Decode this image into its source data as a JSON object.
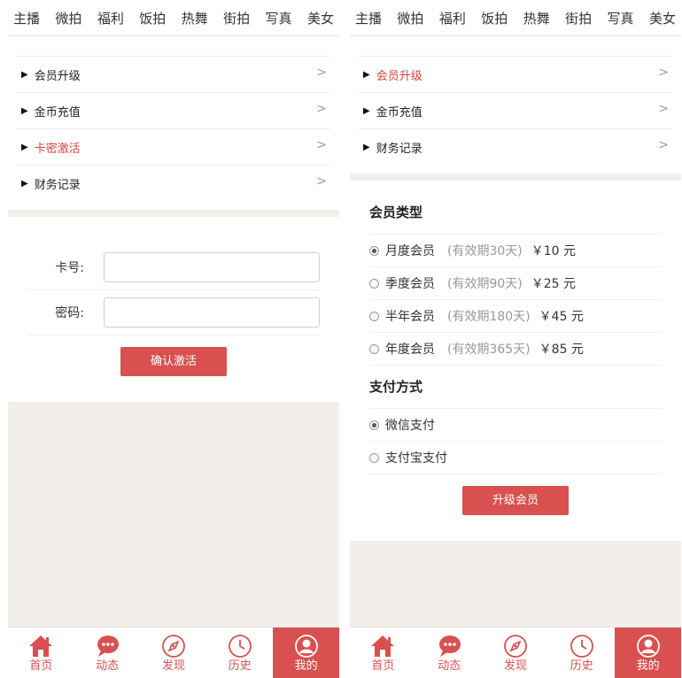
{
  "top_nav": [
    "主播",
    "微拍",
    "福利",
    "饭拍",
    "热舞",
    "街拍",
    "写真",
    "美女"
  ],
  "left": {
    "menu": [
      {
        "label": "会员升级",
        "arrow": ">"
      },
      {
        "label": "金币充值",
        "arrow": ">"
      },
      {
        "label": "卡密激活",
        "arrow": ">"
      },
      {
        "label": "财务记录",
        "arrow": ">"
      }
    ],
    "active_index": 2,
    "form": {
      "card_label": "卡号:",
      "card_value": "",
      "password_label": "密码:",
      "password_value": "",
      "submit_label": "确认激活"
    }
  },
  "right": {
    "menu": [
      {
        "label": "会员升级",
        "arrow": ">"
      },
      {
        "label": "金币充值",
        "arrow": ">"
      },
      {
        "label": "财务记录",
        "arrow": ">"
      }
    ],
    "active_index": 0,
    "member_type_title": "会员类型",
    "member_options": [
      {
        "name": "月度会员",
        "validity": "(有效期30天)",
        "price": "￥10 元",
        "selected": true
      },
      {
        "name": "季度会员",
        "validity": "(有效期90天)",
        "price": "￥25 元",
        "selected": false
      },
      {
        "name": "半年会员",
        "validity": "(有效期180天)",
        "price": "￥45 元",
        "selected": false
      },
      {
        "name": "年度会员",
        "validity": "(有效期365天)",
        "price": "￥85 元",
        "selected": false
      }
    ],
    "payment_title": "支付方式",
    "payment_options": [
      {
        "name": "微信支付",
        "selected": true
      },
      {
        "name": "支付宝支付",
        "selected": false
      }
    ],
    "submit_label": "升级会员"
  },
  "tabbar": [
    {
      "label": "首页",
      "icon": "home-icon"
    },
    {
      "label": "动态",
      "icon": "chat-icon"
    },
    {
      "label": "发现",
      "icon": "compass-icon"
    },
    {
      "label": "历史",
      "icon": "clock-icon"
    },
    {
      "label": "我的",
      "icon": "user-icon"
    }
  ],
  "tabbar_active_index": 4,
  "colors": {
    "accent": "#d8504f",
    "active_text": "#d8443e",
    "background": "#f2eee9"
  }
}
